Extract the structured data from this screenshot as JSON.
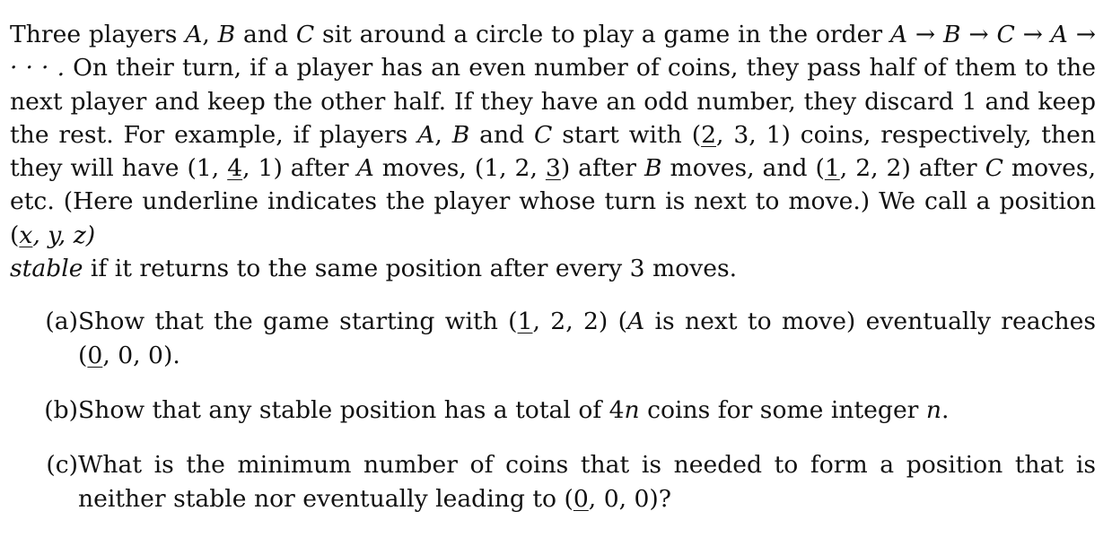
{
  "intro": {
    "t1": "Three players ",
    "A": "A",
    "comma1": ", ",
    "B": "B",
    "and1": " and ",
    "C": "C",
    "t2": " sit around a circle to play a game in the order ",
    "order": "A → B → C → A → · · · .",
    "t3": " On their turn, if a player has an even number of coins, they pass half of them to the next player and keep the other half. If they have an odd number, they discard 1 and keep the rest. For example, if players ",
    "t4": " start with (",
    "ex1_u": "2",
    "ex1_rest": ", 3, 1)",
    "t5": " coins, respectively, then they will have (1, ",
    "ex2_u": "4",
    "ex2_rest": ", 1)",
    "t6": " after ",
    "moves1": " moves, (1, 2, ",
    "ex3_u": "3",
    "ex3_rest": ")",
    "t7": " after ",
    "moves2": " moves, and (",
    "ex4_u": "1",
    "ex4_rest": ", 2, 2)",
    "t8": " after ",
    "moves3": " moves, etc. (Here underline indicates the player whose turn is next to move.) We call a position (",
    "pos_x": "x",
    "pos_rest": ", y, z)",
    "stable": "stable",
    "t9": " if it returns to the same position after every 3 moves."
  },
  "parts": [
    {
      "label": "(a)",
      "t1": "Show that the game starting with (",
      "u1": "1",
      "r1": ", 2, 2)",
      "t2": " (",
      "A": "A",
      "t3": " is next to move) eventually reaches (",
      "u2": "0",
      "r2": ", 0, 0)."
    },
    {
      "label": "(b)",
      "t1": "Show that any stable position has a total of 4",
      "n1": "n",
      "t2": " coins for some integer ",
      "n2": "n",
      "t3": "."
    },
    {
      "label": "(c)",
      "t1": "What is the minimum number of coins that is needed to form a position that is neither stable nor eventually leading to (",
      "u1": "0",
      "r1": ", 0, 0)?"
    }
  ]
}
